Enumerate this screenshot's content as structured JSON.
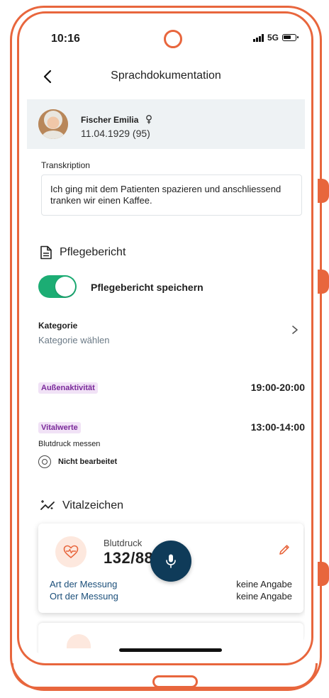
{
  "status_bar": {
    "time": "10:16",
    "network": "5G"
  },
  "header": {
    "title": "Sprachdokumentation"
  },
  "patient": {
    "name": "Fischer Emilia",
    "dob": "11.04.1929 (95)"
  },
  "transcription": {
    "label": "Transkription",
    "text": "Ich ging mit dem Patienten spazieren und anschliessend tranken wir einen Kaffee."
  },
  "pflegebericht": {
    "title": "Pflegebericht",
    "toggle_label": "Pflegebericht speichern",
    "toggle_on": true,
    "category_label": "Kategorie",
    "category_placeholder": "Kategorie wählen"
  },
  "activities": [
    {
      "tag": "Außenaktivität",
      "time": "19:00-20:00"
    },
    {
      "tag": "Vitalwerte",
      "time": "13:00-14:00",
      "task": "Blutdruck messen",
      "status": "Nicht bearbeitet"
    }
  ],
  "vitals": {
    "title": "Vitalzeichen",
    "card": {
      "title": "Blutdruck",
      "value": "132/88",
      "rows": [
        {
          "label": "Art der Messung",
          "value": "keine Angabe"
        },
        {
          "label": "Ort der Messung",
          "value": "keine Angabe"
        }
      ]
    }
  },
  "colors": {
    "accent": "#1cad74",
    "frame": "#e8663d",
    "fab": "#0f3b59",
    "tag_bg": "#f1e2f6",
    "tag_fg": "#7a2a9a"
  }
}
